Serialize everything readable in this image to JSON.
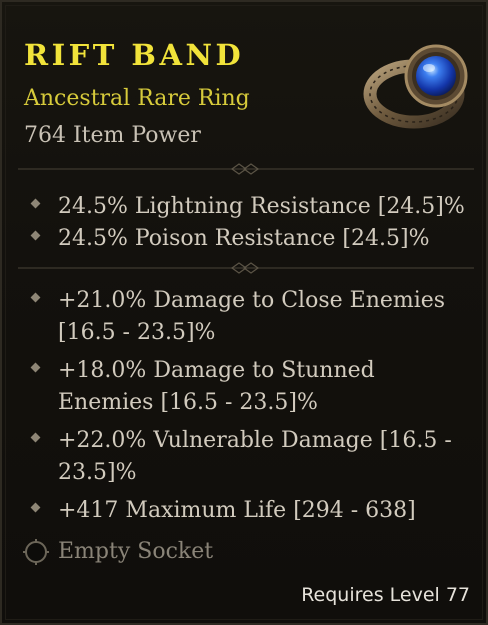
{
  "item": {
    "name": "RIFT BAND",
    "type": "Ancestral Rare Ring",
    "power": "764 Item Power",
    "icon": "ring-icon"
  },
  "implicit_affixes": [
    "24.5% Lightning Resistance [24.5]%",
    "24.5% Poison Resistance [24.5]%"
  ],
  "affixes": [
    "+21.0% Damage to Close Enemies [16.5 - 23.5]%",
    "+18.0% Damage to Stunned Enemies [16.5 - 23.5]%",
    "+22.0% Vulnerable Damage [16.5 - 23.5]%",
    "+417 Maximum Life [294 - 638]"
  ],
  "socket": {
    "label": "Empty Socket"
  },
  "requirement": "Requires Level 77",
  "colors": {
    "name": "#f1e33a",
    "type": "#d7cb3b",
    "affix_text": "#d2cbbe",
    "socket_text": "#8a8478"
  }
}
